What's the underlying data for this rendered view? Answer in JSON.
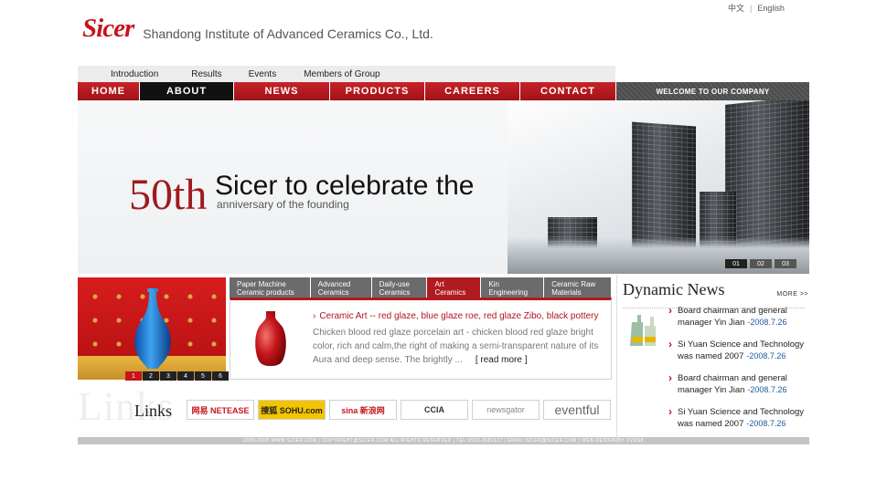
{
  "lang": {
    "zh": "中文",
    "en": "English"
  },
  "logo": {
    "mark_s": "S",
    "mark_rest": "icer",
    "company": "Shandong Institute of Advanced Ceramics Co., Ltd."
  },
  "subnav": [
    "Introduction",
    "Results",
    "Events",
    "Members of Group"
  ],
  "mainnav": [
    "HOME",
    "ABOUT",
    "NEWS",
    "PRODUCTS",
    "CAREERS",
    "CONTACT"
  ],
  "mainnav_active": "ABOUT",
  "welcome": "WELCOME TO OUR COMPANY",
  "banner": {
    "big": "50th",
    "headline": "Sicer to celebrate the",
    "sub": "anniversary of the founding",
    "pager": [
      "01",
      "02",
      "03"
    ]
  },
  "vase_pager": [
    "1",
    "2",
    "3",
    "4",
    "5",
    "6"
  ],
  "tabs": [
    {
      "l1": "Paper Machine",
      "l2": "Ceramic products"
    },
    {
      "l1": "Advanced",
      "l2": "Ceramics"
    },
    {
      "l1": "Daily-use",
      "l2": "Ceramics"
    },
    {
      "l1": "Art",
      "l2": "Ceramics"
    },
    {
      "l1": "Kin",
      "l2": "Engineering"
    },
    {
      "l1": "Ceramic Raw",
      "l2": "Materials"
    }
  ],
  "tab_active_index": 3,
  "tab_content": {
    "title": "Ceramic Art -- red glaze, blue glaze roe, red glaze Zibo, black pottery",
    "desc": "Chicken blood red glaze porcelain art - chicken blood red glaze bright color, rich and calm,the right of making a semi-transparent nature of its Aura and deep sense. The brightly ...",
    "more": "[ read more ]"
  },
  "links": {
    "bg": "Links",
    "title": "Links",
    "logos": [
      "网易 NETEASE",
      "搜狐 SOHU.com",
      "sina 新浪网",
      "CCIA",
      "newsgator",
      "eventful"
    ]
  },
  "footer": "2000-2008 WWW.SICER.COM  |  COPYRIGHT@SICER.COM ALL RIGHTS RESERVED  |  TEL:0533-3582117  |  EMAIL:SICER@SICER.COM  |  WEB-DESIGN BY VVUS8",
  "news": {
    "title": "Dynamic News",
    "more": "MORE >>",
    "items": [
      {
        "text": "Board chairman and general manager Yin Jian",
        "date": "-2008.7.26"
      },
      {
        "text": "Si Yuan Science and Technology was named 2007",
        "date": "-2008.7.26"
      },
      {
        "text": "Board chairman and general manager Yin Jian",
        "date": "-2008.7.26"
      },
      {
        "text": "Si Yuan Science and Technology was named 2007",
        "date": "-2008.7.26"
      }
    ]
  },
  "colors": {
    "brand_red": "#c4161c",
    "nav_dark": "#111111",
    "link_blue": "#1d5a9e"
  }
}
